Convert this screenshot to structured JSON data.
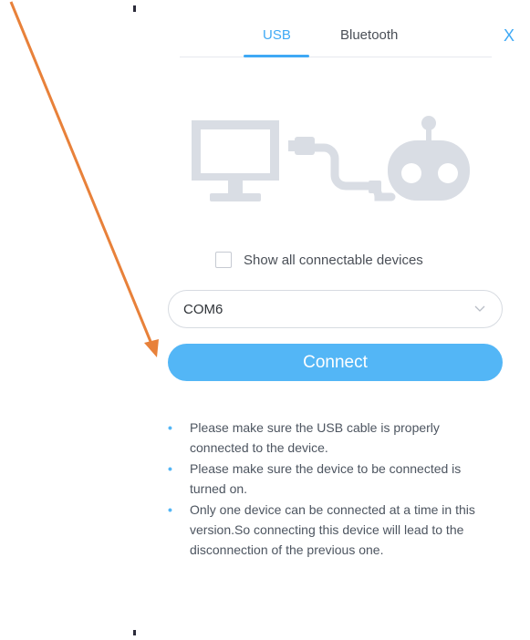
{
  "tabs": [
    {
      "label": "USB",
      "active": true
    },
    {
      "label": "Bluetooth",
      "active": false
    }
  ],
  "close_label": "X",
  "checkbox": {
    "label": "Show all connectable devices",
    "checked": false
  },
  "port_select": {
    "value": "COM6"
  },
  "connect_label": "Connect",
  "tips": [
    "Please make sure the USB cable is properly connected to the device.",
    "Please make sure the device to be connected is turned on.",
    "Only one device can be connected at a time in this version.So connecting this device will lead to the disconnection of the previous one."
  ],
  "colors": {
    "accent": "#3fa9f5",
    "button": "#53b6f6",
    "illustration": "#d9dde4",
    "annotation_arrow": "#e8813a"
  },
  "icons": [
    "monitor-icon",
    "usb-cable-icon",
    "robot-icon",
    "chevron-down-icon",
    "close-icon",
    "annotation-arrow"
  ]
}
